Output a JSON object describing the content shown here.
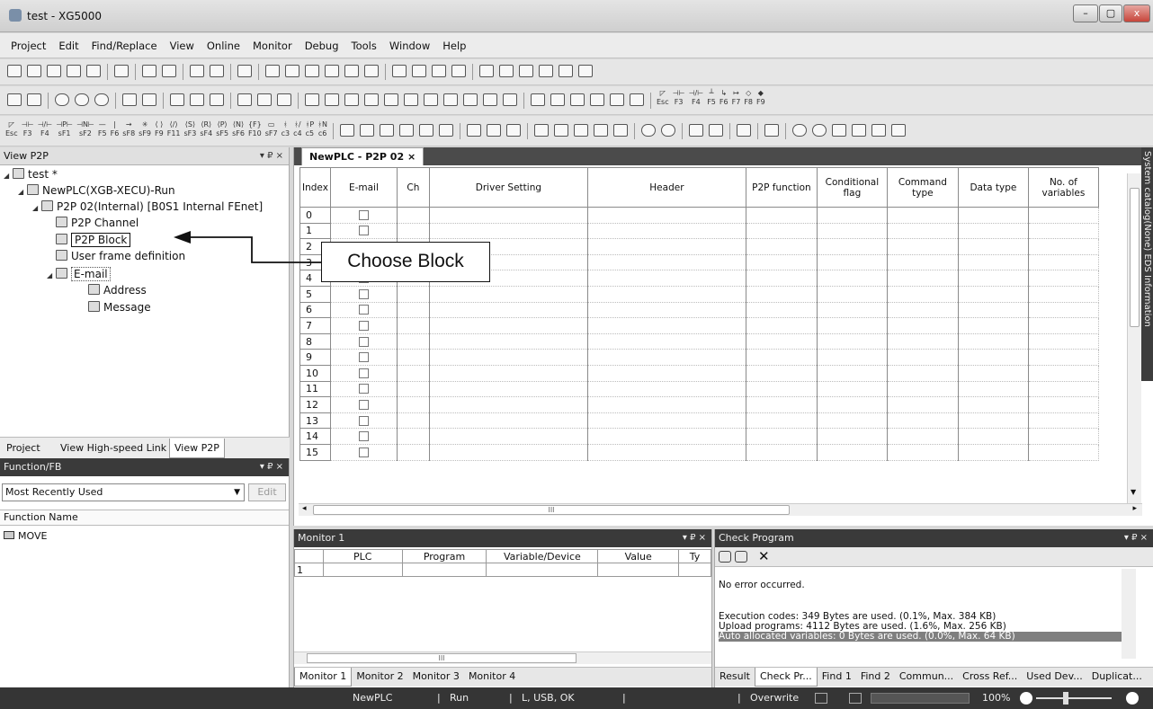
{
  "window": {
    "title": "test - XG5000",
    "buttons": [
      "–",
      "▢",
      "x"
    ]
  },
  "menu": [
    "Project",
    "Edit",
    "Find/Replace",
    "View",
    "Online",
    "Monitor",
    "Debug",
    "Tools",
    "Window",
    "Help"
  ],
  "toolbar4_keys": [
    "Esc",
    "F3",
    "F4",
    "sF1",
    "sF2",
    "F5",
    "F6",
    "sF8",
    "sF9",
    "F9",
    "F11",
    "sF3",
    "sF4",
    "sF5",
    "sF6",
    "F10",
    "sF7",
    "c3",
    "c4",
    "c5",
    "c6"
  ],
  "toolbar3_keys": [
    "Esc",
    "F3",
    "F4",
    "F5",
    "F6",
    "F7",
    "F8",
    "F9"
  ],
  "tree_panel": {
    "title": "View P2P",
    "controls": "▾ ₽ ×",
    "nodes": [
      {
        "label": "test *",
        "icon": "project-icon"
      },
      {
        "label": "NewPLC(XGB-XECU)-Run",
        "icon": "plc-icon"
      },
      {
        "label": "P2P 02(Internal) [B0S1 Internal FEnet]",
        "icon": "p2p-icon"
      },
      {
        "label": "P2P Channel",
        "icon": "channel-icon"
      },
      {
        "label": "P2P Block",
        "icon": "block-icon"
      },
      {
        "label": "User frame definition",
        "icon": "frame-icon"
      },
      {
        "label": "E-mail",
        "icon": "email-icon"
      },
      {
        "label": "Address",
        "icon": "address-icon"
      },
      {
        "label": "Message",
        "icon": "message-icon"
      }
    ]
  },
  "left_tabs": [
    "Project",
    "View High-speed Link",
    "View P2P"
  ],
  "function_panel": {
    "title": "Function/FB",
    "controls": "▾ ₽ ×",
    "dropdown": "Most Recently Used",
    "edit_button": "Edit",
    "column": "Function Name",
    "items": [
      "MOVE"
    ]
  },
  "editor": {
    "tab": "NewPLC - P2P 02",
    "tab_close": "×",
    "columns": [
      "Index",
      "E-mail",
      "Ch",
      "Driver Setting",
      "Header",
      "P2P function",
      "Conditional flag",
      "Command type",
      "Data type",
      "No. of variables"
    ],
    "rows": [
      "0",
      "1",
      "2",
      "3",
      "4",
      "5",
      "6",
      "7",
      "8",
      "9",
      "10",
      "11",
      "12",
      "13",
      "14",
      "15"
    ],
    "hscroll_mark": "III"
  },
  "callout": {
    "text": "Choose Block"
  },
  "monitor": {
    "title": "Monitor 1",
    "controls": "▾ ₽ ×",
    "columns": [
      "PLC",
      "Program",
      "Variable/Device",
      "Value",
      "Ty"
    ],
    "row": "1",
    "scroll_mark": "III",
    "tabs": [
      "Monitor 1",
      "Monitor 2",
      "Monitor 3",
      "Monitor 4"
    ]
  },
  "check_program": {
    "title": "Check Program",
    "controls": "▾ ₽ ×",
    "close_glyph": "✕",
    "lines": [
      "No error occurred.",
      "",
      "Execution codes: 349 Bytes are used. (0.1%, Max. 384 KB)",
      "Upload programs: 4112 Bytes are used. (1.6%, Max. 256 KB)",
      "Auto allocated variables: 0 Bytes are used. (0.0%, Max. 64 KB)"
    ],
    "tabs": [
      "Result",
      "Check Pr...",
      "Find 1",
      "Find 2",
      "Commun...",
      "Cross Ref...",
      "Used Dev...",
      "Duplicat..."
    ]
  },
  "side_vertical_tabs": "System catalog(None)  EDS Information",
  "status": {
    "plc": "NewPLC",
    "mode": "Run",
    "conn": "L, USB, OK",
    "overwrite": "Overwrite",
    "zoom": "100%"
  }
}
